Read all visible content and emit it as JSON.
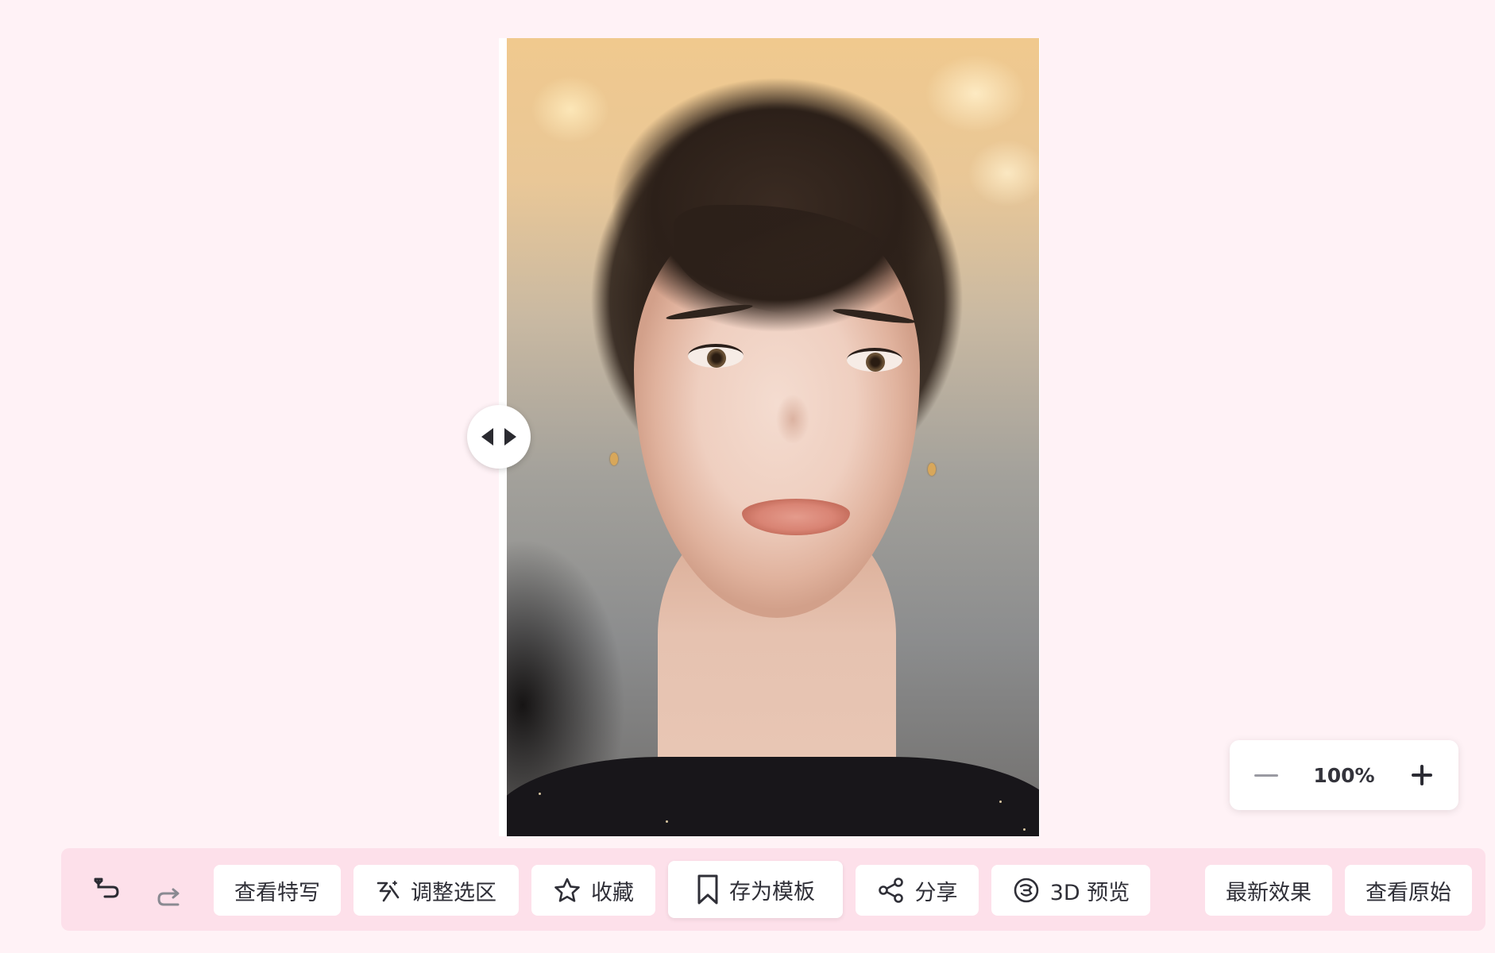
{
  "canvas": {
    "image_alt": "Portrait of a woman with a short dark pixie haircut"
  },
  "compare_handle": {
    "left_icon": "triangle-left-icon",
    "right_icon": "triangle-right-icon"
  },
  "zoom": {
    "value": "100%",
    "minus_icon": "minus-icon",
    "plus_icon": "plus-icon"
  },
  "toolbar": {
    "undo_icon": "undo-icon",
    "redo_icon": "redo-icon",
    "buttons": [
      {
        "label": "查看特写",
        "icon": ""
      },
      {
        "label": "调整选区",
        "icon": "magic-wand-icon"
      },
      {
        "label": "收藏",
        "icon": "star-icon"
      },
      {
        "label": "存为模板",
        "icon": "bookmark-icon"
      },
      {
        "label": "分享",
        "icon": "share-icon"
      },
      {
        "label": "3D 预览",
        "icon": "rotate-3d-icon"
      },
      {
        "label": "最新效果",
        "icon": ""
      },
      {
        "label": "查看原始",
        "icon": ""
      }
    ]
  },
  "colors": {
    "page_background": "#fff2f6",
    "toolbar_background": "#fde0ea",
    "button_background": "#ffffff",
    "text": "#2f2f37"
  }
}
